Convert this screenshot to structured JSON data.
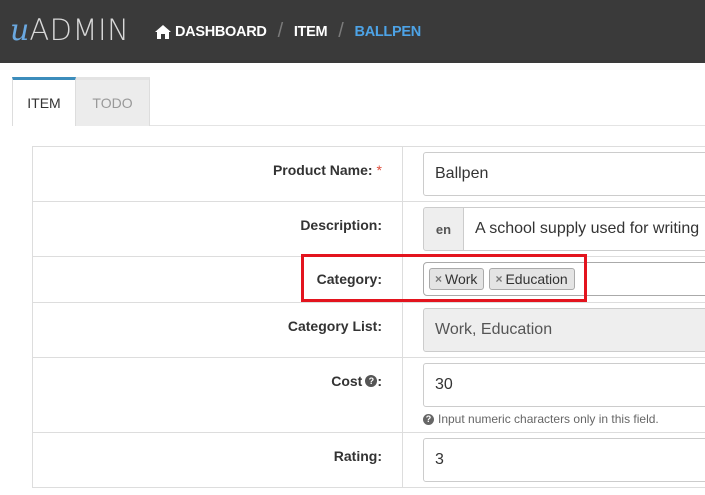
{
  "header": {
    "logo_prefix": "u",
    "logo_text": "ADMIN",
    "breadcrumb": [
      {
        "label": "DASHBOARD",
        "icon": "home-icon"
      },
      {
        "label": "ITEM"
      },
      {
        "label": "BALLPEN"
      }
    ],
    "separator": "/"
  },
  "tabs": [
    {
      "label": "ITEM",
      "active": true
    },
    {
      "label": "TODO",
      "active": false
    }
  ],
  "form": {
    "product_name": {
      "label": "Product Name:",
      "required_mark": "*",
      "value": "Ballpen"
    },
    "description": {
      "label": "Description:",
      "lang": "en",
      "value": "A school supply used for writing"
    },
    "category": {
      "label": "Category:",
      "tags": [
        "Work",
        "Education"
      ],
      "remove_glyph": "×"
    },
    "category_list": {
      "label": "Category List:",
      "value": "Work, Education"
    },
    "cost": {
      "label": "Cost",
      "label_suffix": ":",
      "value": "30",
      "help_text": "Input numeric characters only in this field."
    },
    "rating": {
      "label": "Rating:",
      "value": "3"
    }
  },
  "colors": {
    "topbar": "#3a3a3a",
    "accent": "#4da3e6",
    "highlight": "#e3141e",
    "required": "#dd4b39"
  }
}
